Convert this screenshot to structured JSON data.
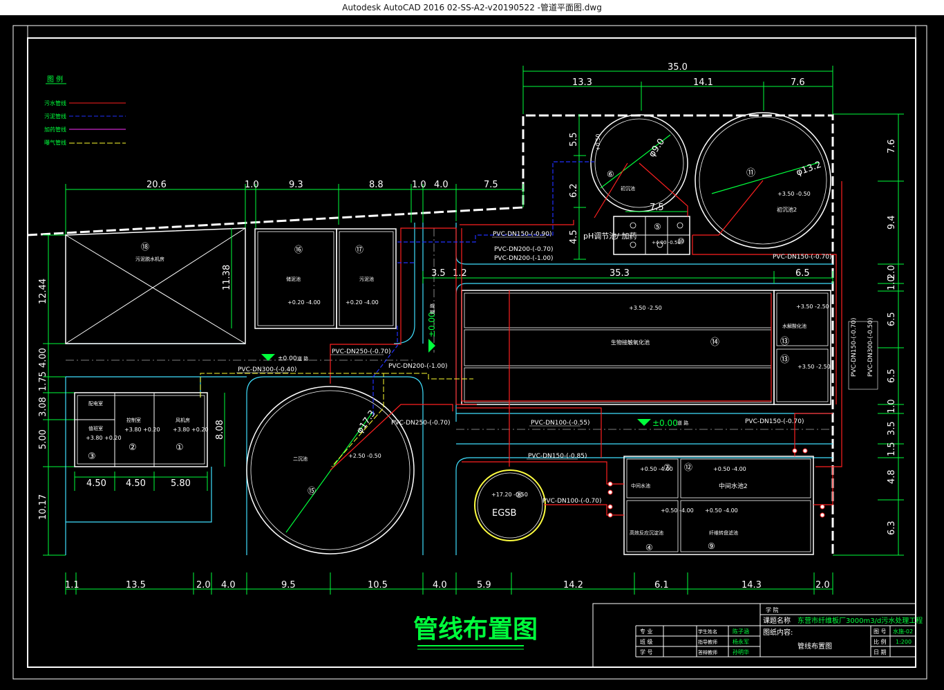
{
  "window": {
    "title": "Autodesk AutoCAD 2016     02-SS-A2-v20190522 -管道平面图.dwg"
  },
  "drawing": {
    "title": "管线布置图",
    "legend": {
      "header": "图 例",
      "items": [
        {
          "label": "污水管线",
          "color": "#ff2020"
        },
        {
          "label": "污泥管线",
          "color": "#2030ff"
        },
        {
          "label": "加药管线",
          "color": "#ff30ff"
        },
        {
          "label": "曝气管线",
          "color": "#ffff30"
        }
      ]
    },
    "dims": {
      "top": [
        "35.0",
        "13.3",
        "14.1",
        "7.6"
      ],
      "mid": [
        "20.6",
        "1.0",
        "9.3",
        "8.8",
        "1.0",
        "4.0",
        "7.5"
      ],
      "bottom": [
        "1.1",
        "13.5",
        "2.0",
        "4.0",
        "9.5",
        "10.5",
        "4.0",
        "5.9",
        "14.2",
        "6.1",
        "14.3",
        "2.0"
      ],
      "left": [
        "12.44",
        "4.00",
        "1.75",
        "3.08",
        "5.00",
        "10.17"
      ],
      "right": [
        "7.6",
        "9.4",
        "2.0",
        "1.0",
        "6.5",
        "6.5",
        "1.0",
        "3.5",
        "1.5",
        "4.8",
        "6.3"
      ],
      "inner": [
        "5.5",
        "6.2",
        "4.5",
        "7.5",
        "11.38",
        "3.5",
        "1.2",
        "35.3",
        "6.5",
        "8.08",
        "4.50",
        "4.50",
        "5.80",
        "φ9.0",
        "φ13.2",
        "φ17.3"
      ]
    },
    "units": {
      "u1": {
        "no": "①",
        "name": "风机房",
        "elev": "+3.80 +0.20"
      },
      "u2": {
        "no": "②",
        "name": "控制室",
        "elev": "+3.80 +0.20"
      },
      "u3": {
        "no": "③",
        "name": "值班室",
        "elev": "+3.80 +0.20",
        "extra": "配电室"
      },
      "u4": {
        "no": "④",
        "name": "高效反应沉淀池",
        "elev": "+0.50 -4.00"
      },
      "u5": {
        "no": "⑤"
      },
      "u6": {
        "no": "⑥",
        "name": "初沉池",
        "elev": "+0.50"
      },
      "u7": {
        "no": "⑦",
        "name": "中间水池",
        "elev": "+0.50 -4.00"
      },
      "u8": {
        "no": "⑧",
        "name": "EGSB",
        "elev": "+17.20 -0.50"
      },
      "u9": {
        "no": "⑨",
        "name": "纤维转盘滤池",
        "elev": "+0.50 -4.00"
      },
      "u10": {
        "no": "⑩",
        "elev": "+4.00 -0.50"
      },
      "u11": {
        "no": "⑪",
        "name": "初沉池2",
        "elev": "+3.50 -0.50"
      },
      "u12": {
        "no": "⑫",
        "name": "中间水池2",
        "elev": "+0.50 -4.00"
      },
      "u13a": {
        "no": "⑬",
        "name": "水解酸化池",
        "elev": "+3.50 -2.50"
      },
      "u13b": {
        "no": "⑬",
        "elev": "+3.50 -2.50"
      },
      "u14": {
        "no": "⑭",
        "name": "生物接触氧化池",
        "elev": "+3.50 -2.50"
      },
      "u15": {
        "no": "⑮",
        "name": "二沉池",
        "elev": "+2.50 -0.50"
      },
      "u16": {
        "no": "⑯",
        "name": "储泥池",
        "elev": "+0.20 -4.00"
      },
      "u17": {
        "no": "⑰",
        "name": "污泥池",
        "elev": "+0.20 -4.00"
      },
      "u18": {
        "no": "⑱",
        "name": "污泥脱水机房"
      },
      "ph": "pH调节池/ 加药"
    },
    "pipes": [
      "PVC-DN150-(-0.90)",
      "PVC-DN200-(-0.70)",
      "PVC-DN200-(-1.00)",
      "PVC-DN150-(-0.70)",
      "PVC-DN250-(-0.70)",
      "PVC-DN300-(-0.40)",
      "PVC-DN200-(-1.00)",
      "PVC-DN250-(-0.70)",
      "PVC-DN100-(-0.55)",
      "PVC-DN150-(-0.70)",
      "PVC-DN150-(-0.85)",
      "PVC-DN100-(-0.70)",
      "PVC-DN150-(-0.70)",
      "PVC-DN300-(-0.50)"
    ],
    "elevations": [
      "±0.00",
      "±0.00",
      "±0.00"
    ],
    "road": "道 路",
    "title_block": {
      "school": "学 院",
      "topic_label": "课题名称",
      "topic": "东营市纤维板厂3000m3/d污水处理工程",
      "content_label": "图纸内容:",
      "content": "管线布置图",
      "drawing_no_label": "图 号",
      "drawing_no": "水施-02",
      "scale_label": "比 例",
      "scale": "1:200",
      "date_label": "日 期",
      "major_label": "专 业",
      "class_label": "班 级",
      "id_label": "学 号",
      "student_label": "学生姓名",
      "student": "陈子涵",
      "advisor_label": "指导教师",
      "advisor": "杨永军",
      "reviewer_label": "答辩教师",
      "reviewer": "孙明华"
    }
  }
}
